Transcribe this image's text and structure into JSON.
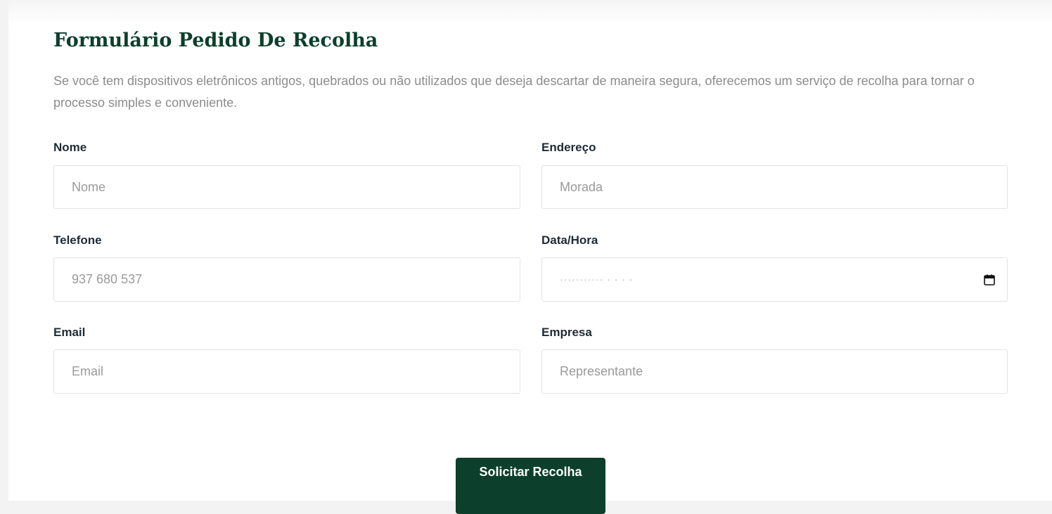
{
  "form": {
    "title": "Formulário Pedido De Recolha",
    "intro": "Se você tem dispositivos eletrônicos antigos, quebrados ou não utilizados que deseja descartar de maneira segura, oferecemos um serviço de recolha para tornar o processo simples e conveniente.",
    "fields": {
      "nome": {
        "label": "Nome",
        "placeholder": "Nome"
      },
      "endereco": {
        "label": "Endereço",
        "placeholder": "Morada"
      },
      "telefone": {
        "label": "Telefone",
        "placeholder": "937 680 537"
      },
      "data_hora": {
        "label": "Data/Hora",
        "placeholder": "··········· · · · ·"
      },
      "email": {
        "label": "Email",
        "placeholder": "Email"
      },
      "empresa": {
        "label": "Empresa",
        "placeholder": "Representante"
      }
    },
    "submit_label": "Solicitar Recolha"
  },
  "icons": {
    "date_picker": "calendar-icon"
  },
  "colors": {
    "brand": "#0c3f2c",
    "label": "#1f2b33",
    "muted": "#8c8c8c",
    "border": "#e2e2e2"
  }
}
